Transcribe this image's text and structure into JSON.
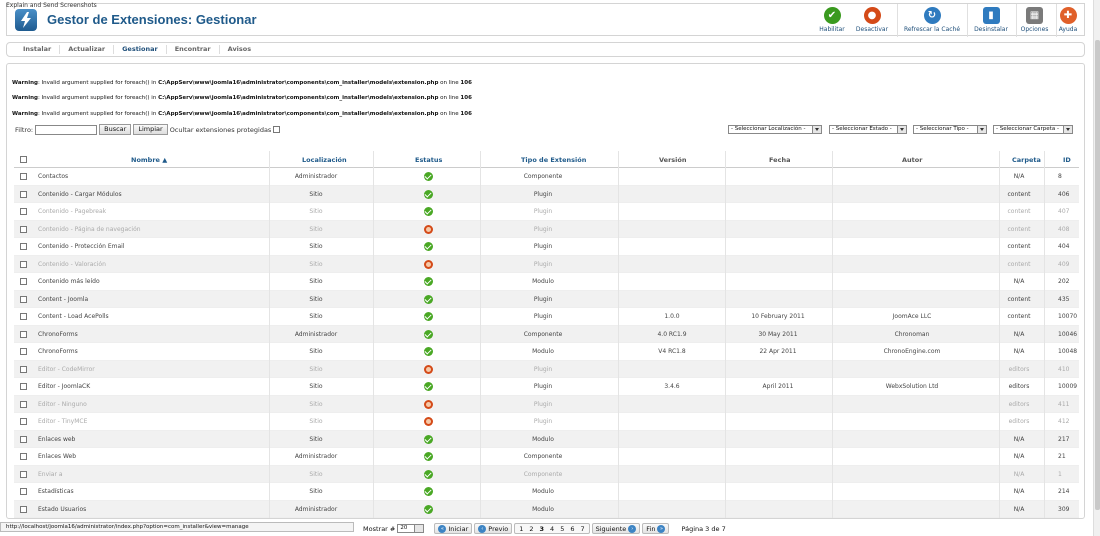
{
  "capture_label": "Explain and Send Screenshots",
  "header": {
    "title": "Gestor de Extensiones: Gestionar"
  },
  "toolbar": [
    {
      "key": "enable",
      "label": "Habilitar",
      "icon": "check-circle-icon",
      "color": "#3a9a1f",
      "glyph": "✔"
    },
    {
      "key": "disable",
      "label": "Desactivar",
      "icon": "disable-circle-icon",
      "color": "#d44a18",
      "glyph": "●"
    },
    {
      "key": "refresh",
      "label": "Refrescar la Caché",
      "icon": "refresh-icon",
      "color": "#2f7bbf",
      "glyph": "↻"
    },
    {
      "key": "uninstall",
      "label": "Desinstalar",
      "icon": "trash-icon",
      "color": "#2f7bbf",
      "glyph": "▮"
    },
    {
      "key": "options",
      "label": "Opciones",
      "icon": "options-icon",
      "color": "#7a7a7a",
      "glyph": "▦"
    },
    {
      "key": "help",
      "label": "Ayuda",
      "icon": "help-icon",
      "color": "#e0602a",
      "glyph": "✚"
    }
  ],
  "submenu": [
    {
      "label": "Instalar",
      "active": false
    },
    {
      "label": "Actualizar",
      "active": false
    },
    {
      "label": "Gestionar",
      "active": true
    },
    {
      "label": "Encontrar",
      "active": false
    },
    {
      "label": "Avisos",
      "active": false
    }
  ],
  "warnings": [
    {
      "prefix": "Warning",
      "text": ": Invalid argument supplied for foreach() in ",
      "path": "C:\\AppServ\\www\\joomla16\\administrator\\components\\com_installer\\models\\extension.php",
      "mid": " on line ",
      "line": "106"
    },
    {
      "prefix": "Warning",
      "text": ": Invalid argument supplied for foreach() in ",
      "path": "C:\\AppServ\\www\\joomla16\\administrator\\components\\com_installer\\models\\extension.php",
      "mid": " on line ",
      "line": "106"
    },
    {
      "prefix": "Warning",
      "text": ": Invalid argument supplied for foreach() in ",
      "path": "C:\\AppServ\\www\\joomla16\\administrator\\components\\com_installer\\models\\extension.php",
      "mid": " on line ",
      "line": "106"
    }
  ],
  "filter": {
    "label": "Filtro:",
    "value": "",
    "search_button": "Buscar",
    "clear_button": "Limpiar",
    "hide_protected_label": "Ocultar extensiones protegidas"
  },
  "selects": {
    "location": "- Seleccionar Localización -",
    "state": "- Seleccionar Estado -",
    "type": "- Seleccionar Tipo -",
    "folder": "- Seleccionar Carpeta -"
  },
  "table": {
    "headers": {
      "name": "Nombre",
      "location": "Localización",
      "status": "Estatus",
      "type": "Tipo de Extensión",
      "version": "Versión",
      "date": "Fecha",
      "author": "Autor",
      "folder": "Carpeta",
      "id": "ID"
    },
    "rows": [
      {
        "name": "Contactos",
        "location": "Administrador",
        "status": "enabled",
        "type": "Componente",
        "version": "",
        "date": "",
        "author": "",
        "folder": "N/A",
        "id": "8",
        "disabled": false
      },
      {
        "name": "Contenido - Cargar Módulos",
        "location": "Sitio",
        "status": "enabled",
        "type": "Plugin",
        "version": "",
        "date": "",
        "author": "",
        "folder": "content",
        "id": "406",
        "disabled": false
      },
      {
        "name": "Contenido - Pagebreak",
        "location": "Sitio",
        "status": "enabled",
        "type": "Plugin",
        "version": "",
        "date": "",
        "author": "",
        "folder": "content",
        "id": "407",
        "disabled": true
      },
      {
        "name": "Contenido - Página de navegación",
        "location": "Sitio",
        "status": "disabled",
        "type": "Plugin",
        "version": "",
        "date": "",
        "author": "",
        "folder": "content",
        "id": "408",
        "disabled": true
      },
      {
        "name": "Contenido - Protección Email",
        "location": "Sitio",
        "status": "enabled",
        "type": "Plugin",
        "version": "",
        "date": "",
        "author": "",
        "folder": "content",
        "id": "404",
        "disabled": false
      },
      {
        "name": "Contenido - Valoración",
        "location": "Sitio",
        "status": "disabled",
        "type": "Plugin",
        "version": "",
        "date": "",
        "author": "",
        "folder": "content",
        "id": "409",
        "disabled": true
      },
      {
        "name": "Contenido más leído",
        "location": "Sitio",
        "status": "enabled",
        "type": "Modulo",
        "version": "",
        "date": "",
        "author": "",
        "folder": "N/A",
        "id": "202",
        "disabled": false
      },
      {
        "name": "Content - Joomla",
        "location": "Sitio",
        "status": "enabled",
        "type": "Plugin",
        "version": "",
        "date": "",
        "author": "",
        "folder": "content",
        "id": "435",
        "disabled": false
      },
      {
        "name": "Content - Load AcePolls",
        "location": "Sitio",
        "status": "enabled",
        "type": "Plugin",
        "version": "1.0.0",
        "date": "10 February 2011",
        "author": "JoomAce LLC",
        "folder": "content",
        "id": "10070",
        "disabled": false
      },
      {
        "name": "ChronoForms",
        "location": "Administrador",
        "status": "enabled",
        "type": "Componente",
        "version": "4.0 RC1.9",
        "date": "30 May 2011",
        "author": "Chronoman",
        "folder": "N/A",
        "id": "10046",
        "disabled": false
      },
      {
        "name": "ChronoForms",
        "location": "Sitio",
        "status": "enabled",
        "type": "Modulo",
        "version": "V4 RC1.8",
        "date": "22 Apr 2011",
        "author": "ChronoEngine.com",
        "folder": "N/A",
        "id": "10048",
        "disabled": false
      },
      {
        "name": "Editor - CodeMirror",
        "location": "Sitio",
        "status": "disabled",
        "type": "Plugin",
        "version": "",
        "date": "",
        "author": "",
        "folder": "editors",
        "id": "410",
        "disabled": true
      },
      {
        "name": "Editor - JoomlaCK",
        "location": "Sitio",
        "status": "enabled",
        "type": "Plugin",
        "version": "3.4.6",
        "date": "April 2011",
        "author": "WebxSolution Ltd",
        "folder": "editors",
        "id": "10009",
        "disabled": false
      },
      {
        "name": "Editor - Ninguno",
        "location": "Sitio",
        "status": "disabled",
        "type": "Plugin",
        "version": "",
        "date": "",
        "author": "",
        "folder": "editors",
        "id": "411",
        "disabled": true
      },
      {
        "name": "Editor - TinyMCE",
        "location": "Sitio",
        "status": "disabled",
        "type": "Plugin",
        "version": "",
        "date": "",
        "author": "",
        "folder": "editors",
        "id": "412",
        "disabled": true
      },
      {
        "name": "Enlaces web",
        "location": "Sitio",
        "status": "enabled",
        "type": "Modulo",
        "version": "",
        "date": "",
        "author": "",
        "folder": "N/A",
        "id": "217",
        "disabled": false
      },
      {
        "name": "Enlaces Web",
        "location": "Administrador",
        "status": "enabled",
        "type": "Componente",
        "version": "",
        "date": "",
        "author": "",
        "folder": "N/A",
        "id": "21",
        "disabled": false
      },
      {
        "name": "Enviar a",
        "location": "Sitio",
        "status": "enabled",
        "type": "Componente",
        "version": "",
        "date": "",
        "author": "",
        "folder": "N/A",
        "id": "1",
        "disabled": true
      },
      {
        "name": "Estadísticas",
        "location": "Sitio",
        "status": "enabled",
        "type": "Modulo",
        "version": "",
        "date": "",
        "author": "",
        "folder": "N/A",
        "id": "214",
        "disabled": false
      },
      {
        "name": "Estado Usuarios",
        "location": "Administrador",
        "status": "enabled",
        "type": "Modulo",
        "version": "",
        "date": "",
        "author": "",
        "folder": "N/A",
        "id": "309",
        "disabled": false
      }
    ]
  },
  "statusbar": {
    "url": "http://localhost/joomla16/administrator/index.php?option=com_installer&view=manage"
  },
  "pagination": {
    "show_label": "Mostrar #",
    "limit": "20",
    "start": "Iniciar",
    "prev": "Previo",
    "pages": [
      "1",
      "2",
      "3",
      "4",
      "5",
      "6",
      "7"
    ],
    "current_page": "3",
    "next": "Siguiente",
    "end": "Fin",
    "summary": "Página 3 de 7"
  }
}
